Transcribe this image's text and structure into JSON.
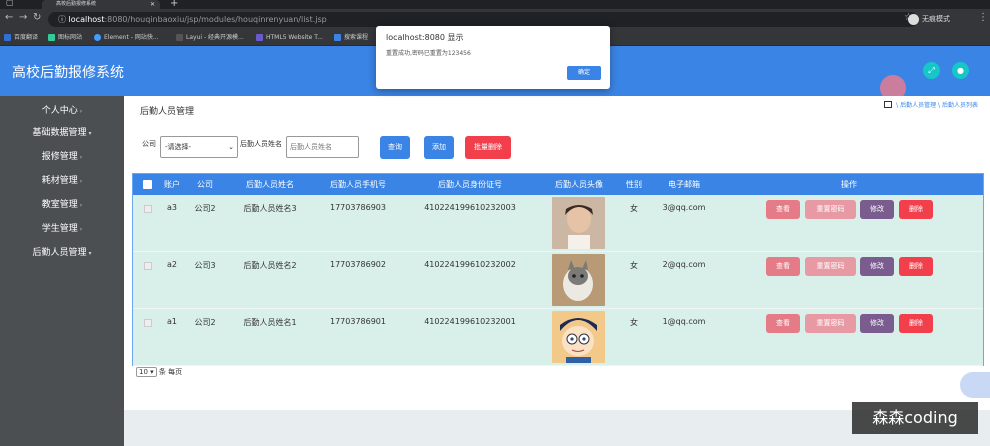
{
  "browser": {
    "tab_title": "高校后勤报修系统",
    "url_host": "localhost",
    "url_rest": ":8080/houqinbaoxiu/jsp/modules/houqinrenyuan/list.jsp",
    "profile_label": "无痕模式",
    "bookmarks": [
      "百度翻译",
      "图标网站",
      "Element - 网站快...",
      "Layui - 经典开源模...",
      "HTML5 Website T...",
      "搜索课程"
    ]
  },
  "app": {
    "title": "高校后勤报修系统"
  },
  "sidebar": {
    "items": [
      {
        "label": "个人中心"
      },
      {
        "label": "基础数据管理"
      },
      {
        "label": "报修管理"
      },
      {
        "label": "耗材管理"
      },
      {
        "label": "教室管理"
      },
      {
        "label": "学生管理"
      },
      {
        "label": "后勤人员管理"
      }
    ]
  },
  "page": {
    "title": "后勤人员管理",
    "crumb_parent": "后勤人员管理",
    "crumb_current": "后勤人员列表",
    "sep": "\\"
  },
  "filters": {
    "company_label": "公司",
    "company_value": "-请选择-",
    "name_label": "后勤人员姓名",
    "name_placeholder": "后勤人员姓名",
    "search": "查询",
    "add": "添加",
    "batch_delete": "批量删除"
  },
  "table": {
    "headers": [
      "账户",
      "公司",
      "后勤人员姓名",
      "后勤人员手机号",
      "后勤人员身份证号",
      "后勤人员头像",
      "性别",
      "电子邮箱",
      "操作"
    ],
    "rows": [
      {
        "account": "a3",
        "company": "公司2",
        "name": "后勤人员姓名3",
        "phone": "17703786903",
        "idcard": "410224199610232003",
        "gender": "女",
        "email": "3@qq.com"
      },
      {
        "account": "a2",
        "company": "公司3",
        "name": "后勤人员姓名2",
        "phone": "17703786902",
        "idcard": "410224199610232002",
        "gender": "女",
        "email": "2@qq.com"
      },
      {
        "account": "a1",
        "company": "公司2",
        "name": "后勤人员姓名1",
        "phone": "17703786901",
        "idcard": "410224199610232001",
        "gender": "女",
        "email": "1@qq.com"
      }
    ],
    "actions": {
      "view": "查看",
      "reset": "重置密码",
      "edit": "修改",
      "delete": "删除"
    }
  },
  "pager": {
    "size": "10",
    "suffix": "条 每页"
  },
  "dialog": {
    "title": "localhost:8080 显示",
    "message": "重置成功,密码已重置为123456",
    "ok": "确定"
  },
  "watermark": "森森coding",
  "colors": {
    "primary": "#3a84e5",
    "danger": "#f1404b",
    "reset": "#e89aa4",
    "edit": "#7a5c8e",
    "row": "#d9efe9",
    "sidebar": "#4b4f52"
  }
}
